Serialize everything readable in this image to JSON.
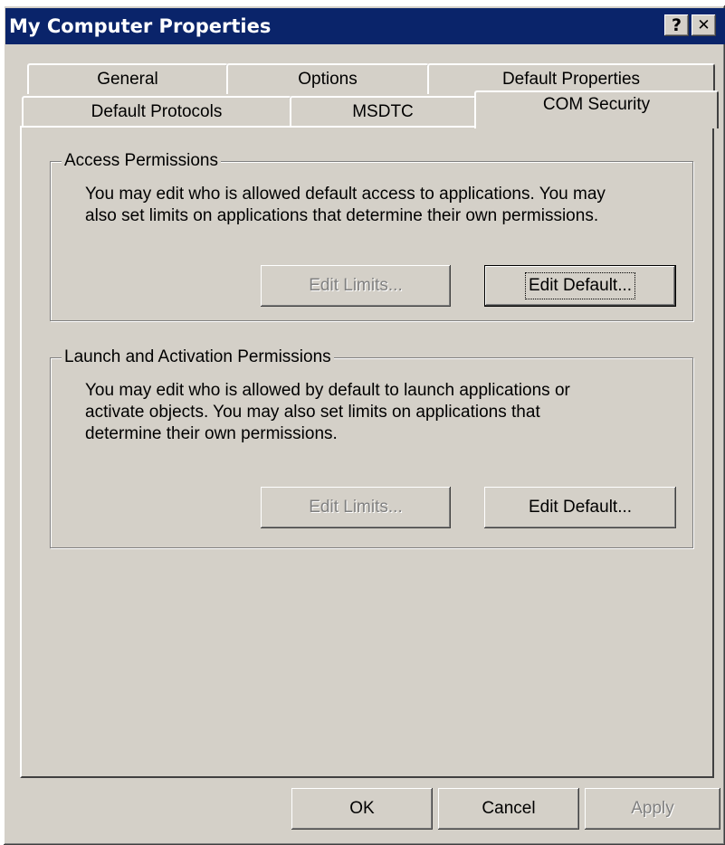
{
  "window": {
    "title": "My Computer Properties",
    "help_button": "?",
    "close_button": "✕"
  },
  "tabs": {
    "row_back": [
      "General",
      "Options",
      "Default Properties"
    ],
    "row_front": [
      "Default Protocols",
      "MSDTC",
      "COM Security"
    ],
    "active": "COM Security"
  },
  "access": {
    "legend": "Access Permissions",
    "line1": "You may edit who is allowed default access to applications. You may",
    "line2": "also set limits on applications that determine their own permissions.",
    "edit_limits": "Edit Limits...",
    "edit_default": "Edit Default..."
  },
  "launch": {
    "legend": "Launch and Activation Permissions",
    "line1": "You may edit who is allowed by default to launch applications or",
    "line2": "activate objects. You may also set limits on applications that",
    "line3": "determine their own permissions.",
    "edit_limits": "Edit Limits...",
    "edit_default": "Edit Default..."
  },
  "footer": {
    "ok": "OK",
    "cancel": "Cancel",
    "apply": "Apply"
  }
}
